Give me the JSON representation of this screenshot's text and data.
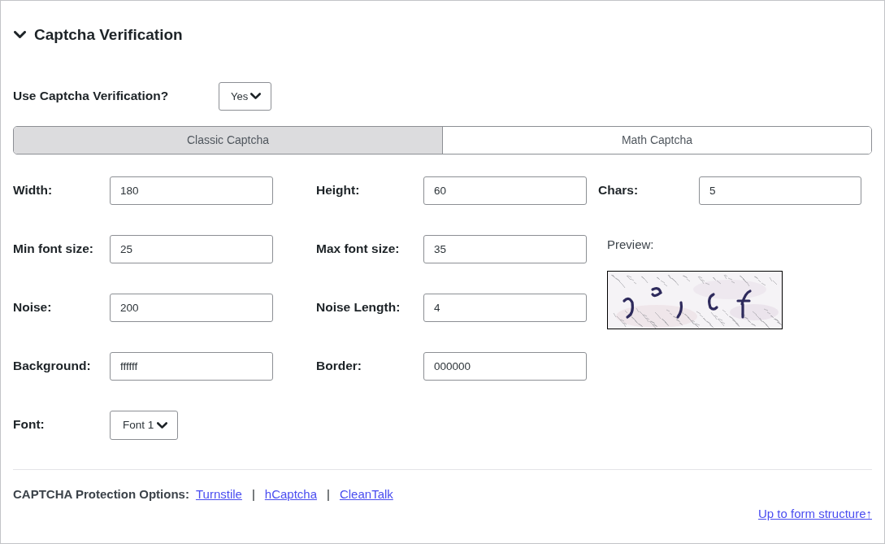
{
  "section": {
    "title": "Captcha Verification",
    "expanded": true
  },
  "use_captcha": {
    "label": "Use Captcha Verification?",
    "value": "Yes"
  },
  "tabs": [
    {
      "label": "Classic Captcha",
      "selected": true
    },
    {
      "label": "Math Captcha",
      "selected": false
    }
  ],
  "settings": {
    "rows": [
      [
        {
          "label": "Width:",
          "kind": "text",
          "value": "180"
        },
        {
          "label": "Height:",
          "kind": "text",
          "value": "60"
        },
        {
          "label": "Chars:",
          "kind": "text",
          "value": "5"
        }
      ],
      [
        {
          "label": "Min font size:",
          "kind": "text",
          "value": "25"
        },
        {
          "label": "Max font size:",
          "kind": "text",
          "value": "35"
        }
      ],
      [
        {
          "label": "Noise:",
          "kind": "text",
          "value": "200"
        },
        {
          "label": "Noise Length:",
          "kind": "text",
          "value": "4"
        }
      ],
      [
        {
          "label": "Background:",
          "kind": "text",
          "value": "ffffff"
        },
        {
          "label": "Border:",
          "kind": "text",
          "value": "000000"
        }
      ],
      [
        {
          "label": "Font:",
          "kind": "select",
          "value": "Font 1"
        }
      ]
    ],
    "preview": {
      "label": "Preview:"
    }
  },
  "footer": {
    "label": "CAPTCHA Protection Options:",
    "items": [
      {
        "kind": "link",
        "text": "Turnstile"
      },
      {
        "kind": "separator",
        "text": "|"
      },
      {
        "kind": "link",
        "text": "hCaptcha"
      },
      {
        "kind": "separator",
        "text": "|"
      },
      {
        "kind": "link",
        "text": "CleanTalk"
      }
    ],
    "back_link": "Up to form structure↑"
  }
}
